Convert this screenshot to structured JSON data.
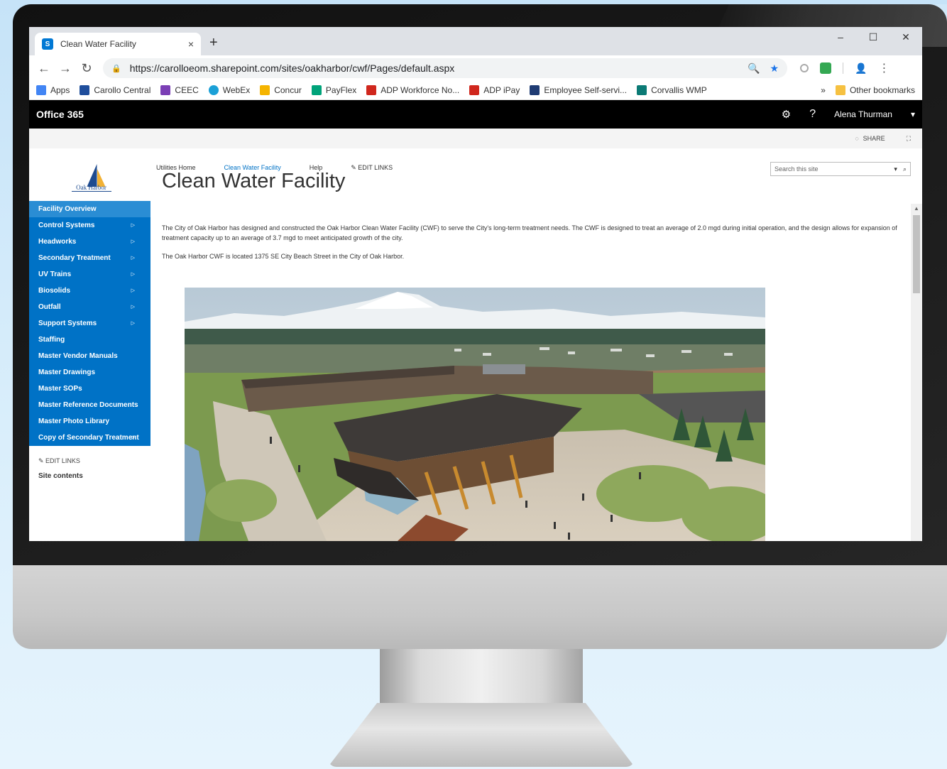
{
  "browser": {
    "tab_title": "Clean Water Facility",
    "tab_close": "×",
    "new_tab": "+",
    "window_controls": [
      "–",
      "☐",
      "✕"
    ],
    "url": "https://carolloeom.sharepoint.com/sites/oakharbor/cwf/Pages/default.aspx",
    "bookmarks": [
      "Apps",
      "Carollo Central",
      "CEEC",
      "WebEx",
      "Concur",
      "PayFlex",
      "ADP Workforce No...",
      "ADP iPay",
      "Employee Self-servi...",
      "Corvallis WMP"
    ],
    "bookmarks_overflow": "»",
    "other_bookmarks": "Other bookmarks"
  },
  "o365": {
    "title": "Office 365",
    "user": "Alena Thurman"
  },
  "ribbon": {
    "share": "SHARE"
  },
  "logo": {
    "text": "Oak Harbor"
  },
  "sidebar": {
    "items": [
      {
        "label": "Facility Overview",
        "arrow": ""
      },
      {
        "label": "Control Systems",
        "arrow": "▷"
      },
      {
        "label": "Headworks",
        "arrow": "▷"
      },
      {
        "label": "Secondary Treatment",
        "arrow": "▷"
      },
      {
        "label": "UV Trains",
        "arrow": "▷"
      },
      {
        "label": "Biosolids",
        "arrow": "▷"
      },
      {
        "label": "Outfall",
        "arrow": "▷"
      },
      {
        "label": "Support Systems",
        "arrow": "▷"
      },
      {
        "label": "Staffing",
        "arrow": ""
      },
      {
        "label": "Master Vendor Manuals",
        "arrow": ""
      },
      {
        "label": "Master Drawings",
        "arrow": ""
      },
      {
        "label": "Master SOPs",
        "arrow": ""
      },
      {
        "label": "Master Reference Documents",
        "arrow": ""
      },
      {
        "label": "Master Photo Library",
        "arrow": ""
      },
      {
        "label": "Copy of Secondary Treatment",
        "arrow": "▷"
      }
    ],
    "edit_links": "EDIT LINKS",
    "site_contents": "Site contents"
  },
  "topnav": {
    "items": [
      "Utilities Home",
      "Clean Water Facility",
      "Help"
    ],
    "edit_links": "EDIT LINKS"
  },
  "search": {
    "placeholder": "Search this site"
  },
  "page": {
    "title": "Clean Water Facility",
    "paragraph1": "The City of Oak Harbor has designed and constructed the Oak Harbor Clean Water Facility (CWF) to serve the City's long-term treatment needs. The CWF is designed to treat an average of 2.0 mgd during initial operation, and the design allows for expansion of treatment capacity up to an average of 3.7 mgd to meet anticipated growth of the city.",
    "paragraph2": "The Oak Harbor CWF is located 1375 SE City Beach Street in the City of Oak Harbor."
  },
  "colors": {
    "quicklaunch": "#0072c6",
    "selected": "#2a8dd4",
    "o365_bar": "#000000",
    "link": "#0072c6"
  }
}
